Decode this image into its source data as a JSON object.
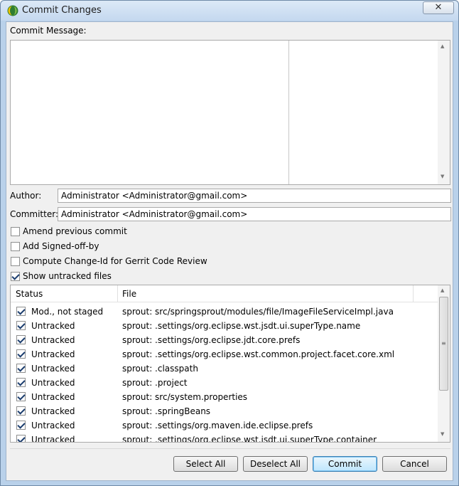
{
  "window": {
    "title": "Commit Changes",
    "close_glyph": "✕"
  },
  "commit_message": {
    "label": "Commit Message:",
    "value": ""
  },
  "author": {
    "label": "Author:",
    "value": "Administrator <Administrator@gmail.com>"
  },
  "committer": {
    "label": "Committer:",
    "value": "Administrator <Administrator@gmail.com>"
  },
  "options": [
    {
      "label": "Amend previous commit",
      "checked": false
    },
    {
      "label": "Add Signed-off-by",
      "checked": false
    },
    {
      "label": "Compute Change-Id for Gerrit Code Review",
      "checked": false
    },
    {
      "label": "Show untracked files",
      "checked": true
    }
  ],
  "table": {
    "columns": [
      "Status",
      "File"
    ],
    "rows": [
      {
        "checked": true,
        "status": "Mod., not staged",
        "file": "sprout: src/springsprout/modules/file/ImageFileServiceImpl.java"
      },
      {
        "checked": true,
        "status": "Untracked",
        "file": "sprout: .settings/org.eclipse.wst.jsdt.ui.superType.name"
      },
      {
        "checked": true,
        "status": "Untracked",
        "file": "sprout: .settings/org.eclipse.jdt.core.prefs"
      },
      {
        "checked": true,
        "status": "Untracked",
        "file": "sprout: .settings/org.eclipse.wst.common.project.facet.core.xml"
      },
      {
        "checked": true,
        "status": "Untracked",
        "file": "sprout: .classpath"
      },
      {
        "checked": true,
        "status": "Untracked",
        "file": "sprout: .project"
      },
      {
        "checked": true,
        "status": "Untracked",
        "file": "sprout: src/system.properties"
      },
      {
        "checked": true,
        "status": "Untracked",
        "file": "sprout: .springBeans"
      },
      {
        "checked": true,
        "status": "Untracked",
        "file": "sprout: .settings/org.maven.ide.eclipse.prefs"
      },
      {
        "checked": true,
        "status": "Untracked",
        "file": "sprout: .settings/org.eclipse.wst.jsdt.ui.superType.container"
      }
    ]
  },
  "buttons": {
    "select_all": "Select All",
    "deselect_all": "Deselect All",
    "commit": "Commit",
    "cancel": "Cancel"
  },
  "colors": {
    "titlebar": "#c4d8ef",
    "dialog_bg": "#f0f0f0",
    "default_button": "#bee6fd"
  }
}
